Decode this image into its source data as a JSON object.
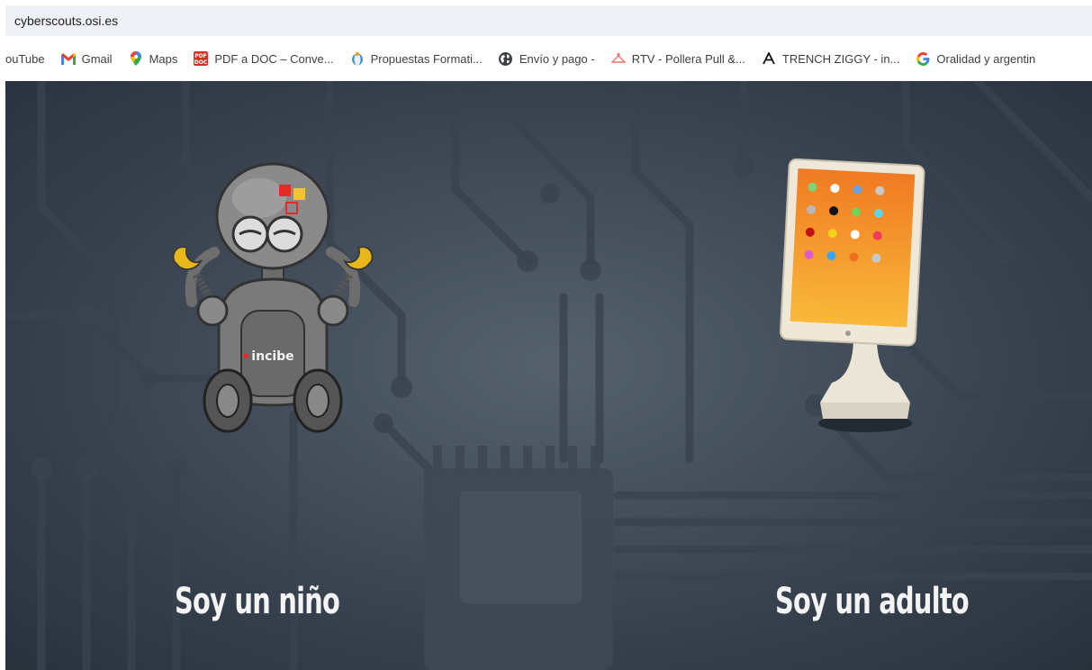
{
  "browser": {
    "url": "cyberscouts.osi.es",
    "bookmarks": [
      {
        "icon": "youtube-icon",
        "label": "ouTube"
      },
      {
        "icon": "gmail-icon",
        "label": "Gmail"
      },
      {
        "icon": "maps-icon",
        "label": "Maps"
      },
      {
        "icon": "pdf-icon",
        "label": "PDF a DOC – Conve..."
      },
      {
        "icon": "government-icon",
        "label": "Propuestas Formati..."
      },
      {
        "icon": "globe-icon",
        "label": "Envío y pago -"
      },
      {
        "icon": "hanger-icon",
        "label": "RTV - Pollera Pull &..."
      },
      {
        "icon": "letter-a-icon",
        "label": "TRENCH ZIGGY - in..."
      },
      {
        "icon": "google-icon",
        "label": "Oralidad y argentin"
      }
    ]
  },
  "hero": {
    "child_option": {
      "label": "Soy un niño",
      "image": "robot-mascot-image",
      "logo_text": "incibe"
    },
    "adult_option": {
      "label": "Soy un adulto",
      "image": "tablet-image"
    }
  },
  "colors": {
    "background": "#3f4a57",
    "label": "#f4f4f4",
    "tablet_screen_top": "#f07a22",
    "tablet_screen_bottom": "#f9b93a"
  }
}
